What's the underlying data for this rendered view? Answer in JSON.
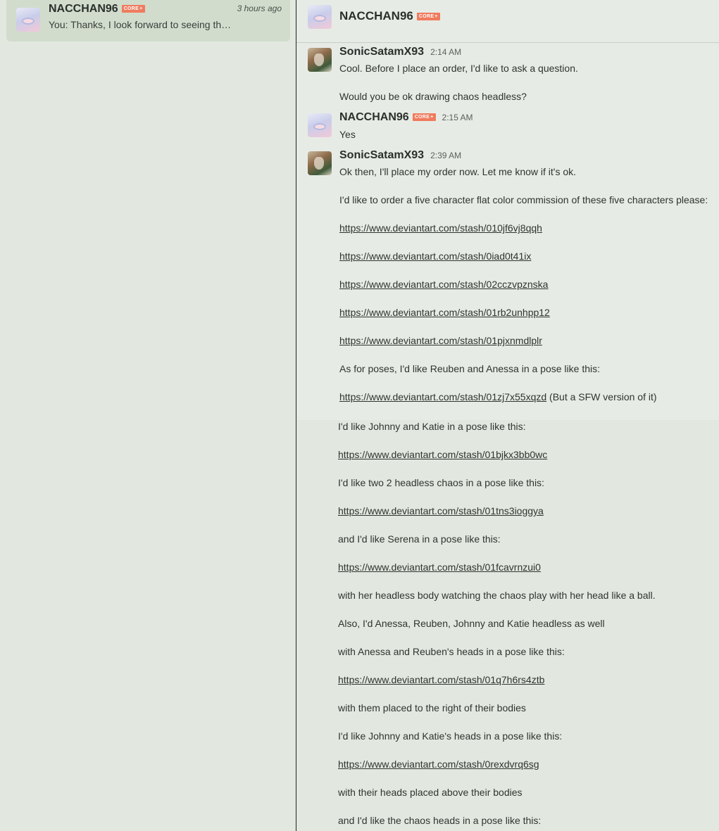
{
  "conversation": {
    "name": "NACCHAN96",
    "badge": "CORE",
    "time": "3 hours ago",
    "preview": "You: Thanks, I look forward to seeing th…"
  },
  "chat_header": {
    "name": "NACCHAN96",
    "badge": "CORE"
  },
  "messages": [
    {
      "author": "SonicSatamX93",
      "time": "2:14 AM"
    },
    {
      "author": "NACCHAN96",
      "badge": "CORE",
      "time": "2:15 AM"
    },
    {
      "author": "SonicSatamX93",
      "time": "2:39 AM"
    }
  ],
  "lines": {
    "m1_l1": "Cool. Before I place an order, I'd like to ask a question.",
    "m1_l2": "Would you be ok drawing chaos headless?",
    "m2_l1": "Yes",
    "m3_l1": "Ok then, I'll place my order now. Let me know if it's ok.",
    "m3_l2": "I'd like to order a five character flat color commission of these five characters please:",
    "link1": "https://www.deviantart.com/stash/010jf6vj8qqh",
    "link2": "https://www.deviantart.com/stash/0iad0t41ix",
    "link3": "https://www.deviantart.com/stash/02cczvpznska",
    "link4": "https://www.deviantart.com/stash/01rb2unhpp12",
    "link5": "https://www.deviantart.com/stash/01pjxnmdlplr",
    "poses_intro": "As for poses, I'd like Reuben and Anessa in a pose like this:",
    "link6": "https://www.deviantart.com/stash/01zj7x55xqzd",
    "link6_suffix": " (But a SFW version of it)",
    "johnny_katie": "I'd like Johnny and Katie in a pose like this:",
    "link7": "https://www.deviantart.com/stash/01bjkx3bb0wc",
    "two_chaos": "I'd like two 2 headless chaos in a pose like this:",
    "link8": "https://www.deviantart.com/stash/01tns3ioggya",
    "serena": "and I'd like Serena in a pose like this:",
    "link9": "https://www.deviantart.com/stash/01fcavrnzui0",
    "headless_body": "with her headless body watching the chaos play with her head like a ball.",
    "also": "Also, I'd Anessa, Reuben, Johnny and Katie headless as well",
    "anessa_heads": "with Anessa and Reuben's heads in a pose like this:",
    "link10": "https://www.deviantart.com/stash/01q7h6rs4ztb",
    "right_of_bodies": "with them placed to the right of their bodies",
    "johnny_heads": "I'd like Johnny and Katie's heads in a pose like this:",
    "link11": "https://www.deviantart.com/stash/0rexdvrq6sg",
    "above_bodies": "with their heads placed above their bodies",
    "chaos_heads": "and I'd like the chaos heads in a pose like this:"
  }
}
